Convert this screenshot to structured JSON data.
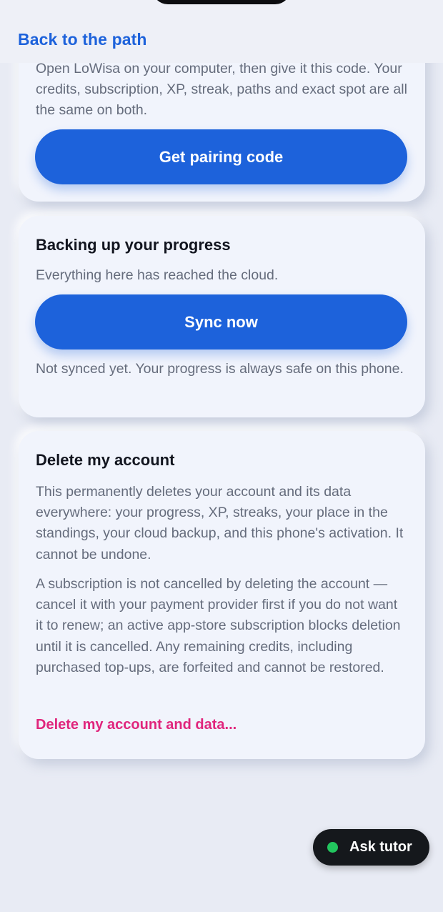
{
  "header": {
    "back_label": "Back to the path"
  },
  "pairing": {
    "description": "Open LoWisa on your computer, then give it this code. Your credits, subscription, XP, streak, paths and exact spot are all the same on both.",
    "button_label": "Get pairing code"
  },
  "backup": {
    "title": "Backing up your progress",
    "status": "Everything here has reached the cloud.",
    "button_label": "Sync now",
    "note": "Not synced yet. Your progress is always safe on this phone."
  },
  "delete": {
    "title": "Delete my account",
    "paragraph1": "This permanently deletes your account and its data everywhere: your progress, XP, streaks, your place in the standings, your cloud backup, and this phone's activation. It cannot be undone.",
    "paragraph2": "A subscription is not cancelled by deleting the account — cancel it with your payment provider first if you do not want it to renew; an active app-store subscription blocks deletion until it is cancelled. Any remaining credits, including purchased top-ups, are forfeited and cannot be restored.",
    "link_label": "Delete my account and data..."
  },
  "tutor": {
    "label": "Ask tutor"
  },
  "colors": {
    "accent": "#1d62db",
    "danger": "#e0257c",
    "online": "#22c55e"
  }
}
